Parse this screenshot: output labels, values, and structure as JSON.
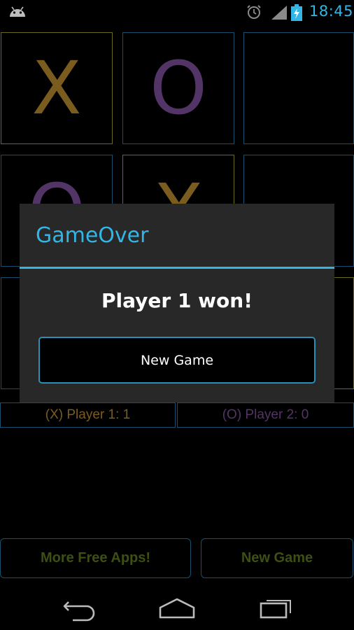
{
  "status_bar": {
    "time": "18:45",
    "icons": [
      "android-icon",
      "alarm-icon",
      "signal-icon",
      "battery-charging-icon"
    ],
    "accent_color": "#33b5e5"
  },
  "board": {
    "cells": [
      {
        "mark": "X",
        "border": "yellow"
      },
      {
        "mark": "O",
        "border": "blue"
      },
      {
        "mark": "",
        "border": "blue"
      },
      {
        "mark": "O",
        "border": "blue"
      },
      {
        "mark": "X",
        "border": "yellow"
      },
      {
        "mark": "",
        "border": "blue"
      },
      {
        "mark": "",
        "border": "blue"
      },
      {
        "mark": "",
        "border": "blue"
      },
      {
        "mark": "",
        "border": "yellow"
      }
    ],
    "x_color": "#7a5c1f",
    "o_color": "#533466"
  },
  "scoreboard": {
    "player1": "(X) Player 1: 1",
    "player2": "(O) Player 2: 0"
  },
  "bottom_buttons": {
    "more_apps": "More Free Apps!",
    "new_game": "New Game"
  },
  "dialog": {
    "title": "GameOver",
    "message": "Player 1 won!",
    "button": "New Game"
  },
  "nav_bar": {
    "icons": [
      "back-icon",
      "home-icon",
      "recent-apps-icon"
    ]
  }
}
